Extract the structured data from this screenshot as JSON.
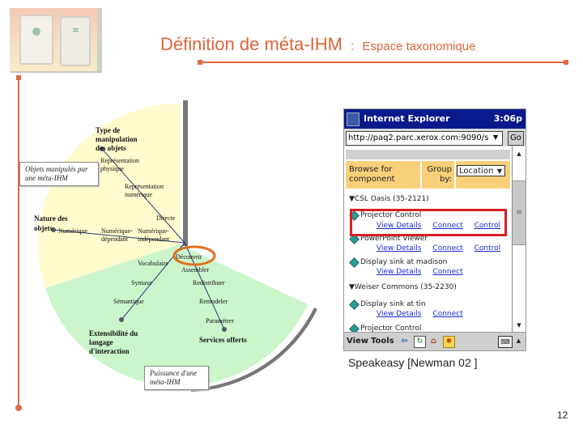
{
  "slide": {
    "title_main": "Définition de méta-IHM",
    "title_sep": ":",
    "title_sub": "Espace taxonomique",
    "page_number": "12",
    "accent_color": "#e0643a"
  },
  "diagram": {
    "sector_colors": {
      "yellow": "#fffbcc",
      "green": "#ccf5cc"
    },
    "box_top": "Objets manipulés par une méta-IHM",
    "box_bottom": "Puissance d'une méta-IHM",
    "axes": [
      {
        "title": "Type de manipulation des objets",
        "ticks": [
          "Représentation physique",
          "Représentation numérique",
          "Directe"
        ]
      },
      {
        "title": "Nature des objets",
        "ticks": [
          "Numérique",
          "Numérique-dépendant",
          "Numérique-indépendant"
        ]
      },
      {
        "title": "Extensibilité du langage d'interaction",
        "ticks": [
          "Vocabulaire",
          "Syntaxe",
          "Sémantique"
        ]
      },
      {
        "title": "Services offerts",
        "ticks": [
          "Découvrir",
          "Assembler",
          "Redistribuer",
          "Remodeler",
          "Paramétrer"
        ]
      }
    ],
    "highlighted": "Découvrir"
  },
  "pda": {
    "app_title": "Internet Explorer",
    "time": "3:06p",
    "url": "http://paq2.parc.xerox.com:9090/s",
    "go_label": "Go",
    "browse_label": "Browse for component",
    "group_label": "Group by:",
    "group_value": "Location",
    "groups": [
      {
        "name": "CSL Oasis (35-2121)",
        "items": [
          {
            "name": "Projector Control",
            "links": [
              "View Details",
              "Connect",
              "Control"
            ],
            "highlighted": true
          },
          {
            "name": "PowerPoint Viewer",
            "links": [
              "View Details",
              "Connect",
              "Control"
            ]
          },
          {
            "name": "Display sink at madison",
            "links": [
              "View Details",
              "Connect"
            ]
          }
        ]
      },
      {
        "name": "Weiser Commons (35-2230)",
        "items": [
          {
            "name": "Display sink at tin",
            "links": [
              "View Details",
              "Connect"
            ]
          },
          {
            "name": "Projector Control",
            "links": []
          }
        ]
      }
    ],
    "toolbar": {
      "view": "View",
      "tools": "Tools"
    },
    "caption": "Speakeasy [Newman 02 ]"
  }
}
